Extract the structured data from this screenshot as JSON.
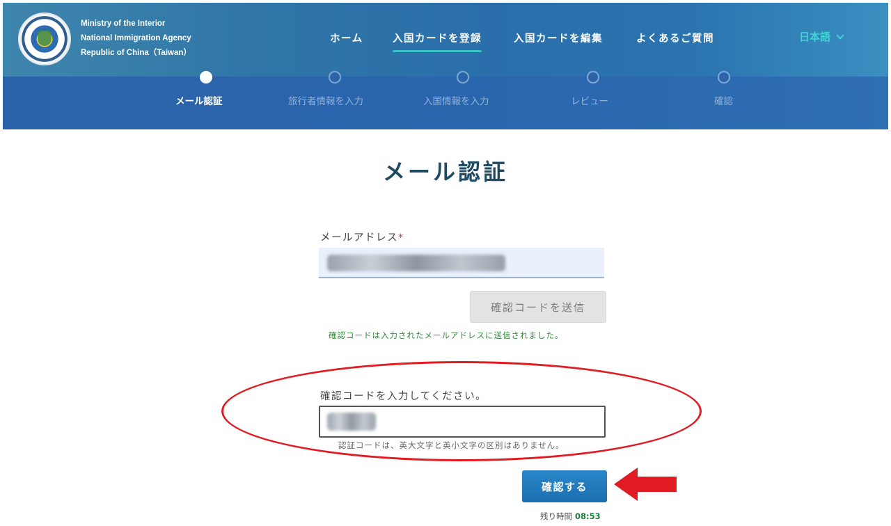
{
  "header": {
    "agency_lines": [
      "Ministry of the Interior",
      "National Immigration Agency",
      "Republic of China（Taiwan）"
    ],
    "nav": [
      {
        "label": "ホーム",
        "active": false
      },
      {
        "label": "入国カードを登録",
        "active": true
      },
      {
        "label": "入国カードを編集",
        "active": false
      },
      {
        "label": "よくあるご質問",
        "active": false
      }
    ],
    "language": "日本語"
  },
  "steps": [
    {
      "label": "メール認証",
      "active": true
    },
    {
      "label": "旅行者情報を入力",
      "active": false
    },
    {
      "label": "入国情報を入力",
      "active": false
    },
    {
      "label": "レビュー",
      "active": false
    },
    {
      "label": "確認",
      "active": false
    }
  ],
  "main": {
    "title": "メール認証",
    "email_label": "メールアドレス",
    "required_mark": "*",
    "send_button": "確認コードを送信",
    "sent_message": "確認コードは入力されたメールアドレスに送信されました。",
    "code_label": "確認コードを入力してください。",
    "code_hint": "認証コードは、英大文字と英小文字の区別はありません。",
    "confirm_button": "確認する",
    "timer_label": "残り時間",
    "timer_value": "08:53"
  },
  "colors": {
    "header_blue": "#2f76a7",
    "accent_teal": "#39c3c7",
    "confirm_blue": "#1b6fb0",
    "success_green": "#2f8a36",
    "annotation_red": "#e11b22"
  }
}
